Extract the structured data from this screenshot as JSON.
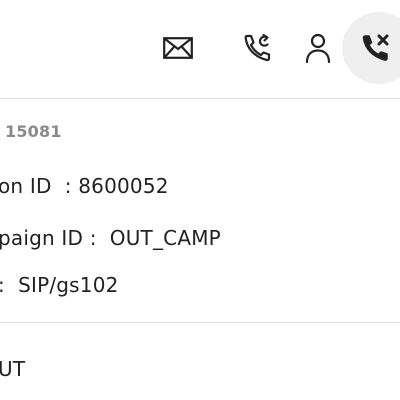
{
  "toolbar": {
    "icons": [
      "mail-icon",
      "phone-callback-icon",
      "user-icon",
      "hang-up-icon"
    ]
  },
  "call_details": {
    "call_number": "15081",
    "fields": [
      {
        "label": "on ID",
        "separator": ":",
        "value": "8600052"
      },
      {
        "label": "paign ID",
        "separator": ":",
        "value": "OUT_CAMP"
      },
      {
        "label": "",
        "separator": ":",
        "value": "SIP/gs102"
      }
    ]
  },
  "footer": {
    "text": "UT"
  },
  "colors": {
    "text": "#222222",
    "muted": "#8a8a8a",
    "divider": "#dcdcdc",
    "hangup_bg": "#efefef"
  }
}
